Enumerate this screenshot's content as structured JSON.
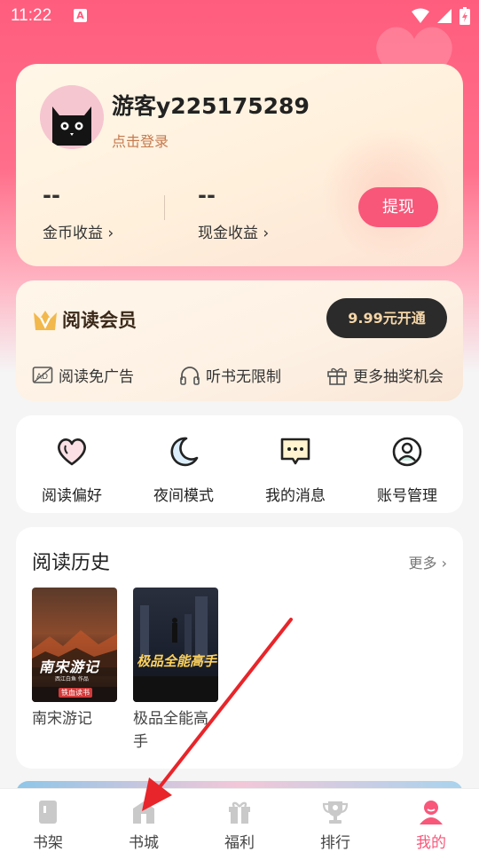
{
  "status_bar": {
    "time": "11:22",
    "badge": "A"
  },
  "profile": {
    "username": "游客y225175289",
    "login_text": "点击登录",
    "coin_value": "--",
    "coin_label": "金币收益 ›",
    "cash_value": "--",
    "cash_label": "现金收益 ›",
    "withdraw_label": "提现"
  },
  "vip": {
    "title": "阅读会员",
    "button": "9.99元开通",
    "perks": [
      "阅读免广告",
      "听书无限制",
      "更多抽奖机会"
    ]
  },
  "actions": [
    {
      "label": "阅读偏好",
      "icon": "heart-icon"
    },
    {
      "label": "夜间模式",
      "icon": "moon-icon"
    },
    {
      "label": "我的消息",
      "icon": "message-icon"
    },
    {
      "label": "账号管理",
      "icon": "account-icon"
    }
  ],
  "history": {
    "title": "阅读历史",
    "more": "更多 ›",
    "books": [
      {
        "title": "南宋游记",
        "cover_text": "南宋游记",
        "cover_author": "西江白鱼 作品",
        "cover_brand": "铁血读书"
      },
      {
        "title": "极品全能高手",
        "cover_text": "极品全能高手"
      }
    ]
  },
  "tabs": [
    {
      "label": "书架",
      "icon": "bookshelf-icon"
    },
    {
      "label": "书城",
      "icon": "bookstore-icon"
    },
    {
      "label": "福利",
      "icon": "gift-icon"
    },
    {
      "label": "排行",
      "icon": "trophy-icon"
    },
    {
      "label": "我的",
      "icon": "profile-icon",
      "active": true
    }
  ],
  "colors": {
    "accent": "#f8577a",
    "header": "#ff5d7d",
    "vip_button": "#2b2b2b",
    "annotation_arrow": "#e8252a"
  }
}
